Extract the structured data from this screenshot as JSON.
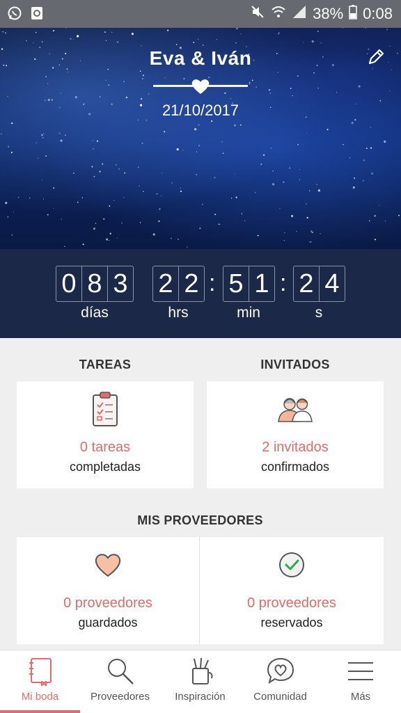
{
  "status_bar": {
    "battery": "38%",
    "time": "0:08"
  },
  "hero": {
    "title": "Eva & Iván",
    "date": "21/10/2017"
  },
  "countdown": {
    "days": [
      "0",
      "8",
      "3"
    ],
    "hours": [
      "2",
      "2"
    ],
    "minutes": [
      "5",
      "1"
    ],
    "seconds": [
      "2",
      "4"
    ],
    "labels": {
      "days": "días",
      "hours": "hrs",
      "minutes": "min",
      "seconds": "s"
    }
  },
  "tasks": {
    "title": "TAREAS",
    "count": "0 tareas",
    "subtitle": "completadas"
  },
  "guests": {
    "title": "INVITADOS",
    "count": "2 invitados",
    "subtitle": "confirmados"
  },
  "providers": {
    "title": "MIS PROVEEDORES",
    "saved": {
      "count": "0 proveedores",
      "subtitle": "guardados"
    },
    "reserved": {
      "count": "0 proveedores",
      "subtitle": "reservados"
    }
  },
  "nav": {
    "items": [
      {
        "label": "Mi boda",
        "icon": "notebook-icon",
        "active": true
      },
      {
        "label": "Proveedores",
        "icon": "search-icon"
      },
      {
        "label": "Inspiración",
        "icon": "pencil-cup-icon"
      },
      {
        "label": "Comunidad",
        "icon": "chat-heart-icon"
      },
      {
        "label": "Más",
        "icon": "menu-icon"
      }
    ]
  },
  "colors": {
    "accent": "#e26b6b",
    "countdown_bg": "#1b2848",
    "status_bar": "#666a70"
  }
}
